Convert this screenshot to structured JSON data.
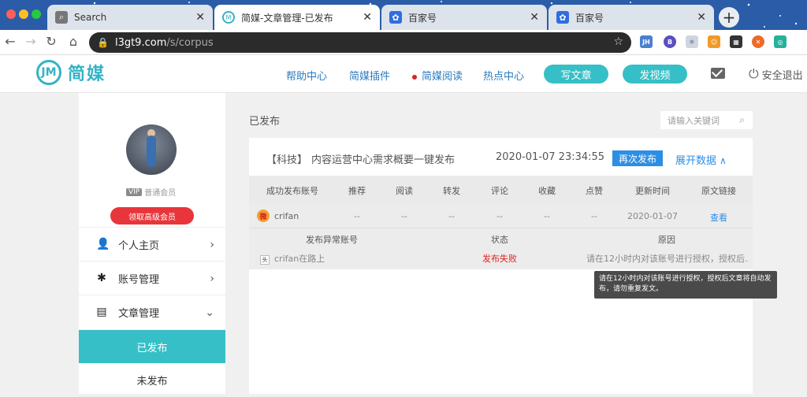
{
  "browser": {
    "tabs": [
      {
        "label": "Search",
        "icon": "search-icon"
      },
      {
        "label": "简媒-文章管理-已发布",
        "icon": "jianmei-icon"
      },
      {
        "label": "百家号",
        "icon": "paw-icon"
      },
      {
        "label": "百家号",
        "icon": "paw-icon"
      }
    ],
    "url_host": "l3gt9.com",
    "url_path": "/s/corpus",
    "extensions": [
      "JH",
      "B",
      "❄",
      "☺",
      "▦",
      "✕",
      "◎"
    ]
  },
  "site": {
    "logo_mark": "JM",
    "logo_text": "简媒",
    "nav": [
      "帮助中心",
      "简媒插件",
      "简媒阅读",
      "热点中心"
    ],
    "write_button": "写文章",
    "video_button": "发视频",
    "logout_label": "安全退出"
  },
  "sidebar": {
    "vip_tag": "VIP",
    "member_label": "普通会员",
    "upgrade_button": "领取高级会员",
    "items": [
      {
        "label": "个人主页",
        "icon": "person-icon"
      },
      {
        "label": "账号管理",
        "icon": "accounts-icon"
      },
      {
        "label": "文章管理",
        "icon": "document-icon"
      },
      {
        "label": "已发布"
      },
      {
        "label": "未发布"
      }
    ]
  },
  "main": {
    "title": "已发布",
    "search_placeholder": "请输入关键词",
    "article": {
      "category": "【科技】",
      "title": "内容运营中心需求概要一键发布",
      "time": "2020-01-07 23:34:55",
      "republish": "再次发布",
      "expand": "展开数据",
      "expand_icon": "∧"
    },
    "table": {
      "headers": [
        "成功发布账号",
        "推荐",
        "阅读",
        "转发",
        "评论",
        "收藏",
        "点赞",
        "更新时间",
        "原文链接"
      ],
      "row": {
        "account": "crifan",
        "values": [
          "--",
          "--",
          "--",
          "--",
          "--",
          "--"
        ],
        "updated": "2020-01-07",
        "link": "查看"
      }
    },
    "errors": {
      "headers": [
        "发布异常账号",
        "状态",
        "原因"
      ],
      "row": {
        "account": "crifan在路上",
        "status": "发布失败",
        "reason": "请在12小时内对该账号进行授权，授权后..."
      }
    },
    "tooltip": "请在12小时内对该账号进行授权，授权后文章将自动发布，请勿重复发文。"
  },
  "colors": {
    "accent": "#36bfc6",
    "link": "#2d8ee5",
    "danger": "#e02020",
    "tabstrip": "#2a5ca8"
  }
}
